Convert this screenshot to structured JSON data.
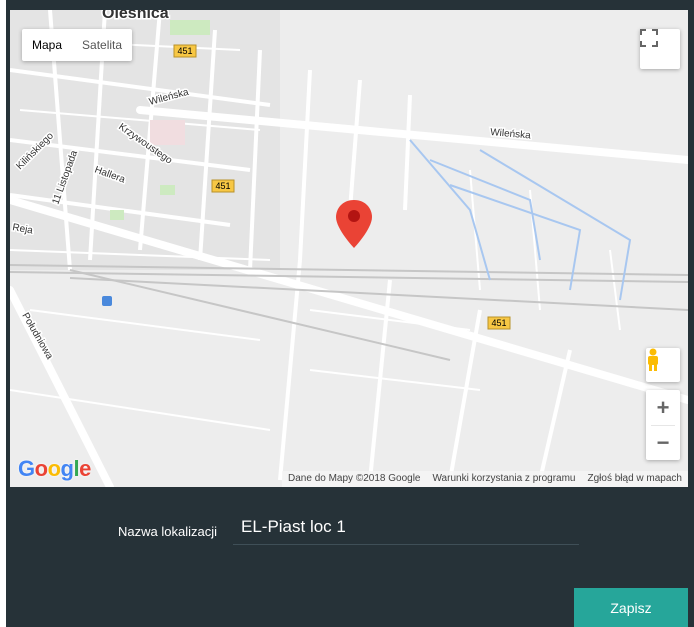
{
  "map": {
    "maptype": {
      "map_label": "Mapa",
      "satellite_label": "Satelita",
      "active": "Mapa"
    },
    "city_label": "Oleśnica",
    "streets": [
      "Wileńska",
      "Wileńska",
      "Krzywoustego",
      "Kilińskiego",
      "11 Listopada",
      "Hallera",
      "Reja",
      "Południowa"
    ],
    "road_shields": [
      "451",
      "451",
      "451"
    ],
    "attribution": {
      "data": "Dane do Mapy ©2018 Google",
      "terms": "Warunki korzystania z programu",
      "report": "Zgłoś błąd w mapach"
    },
    "logo": "Google",
    "icons": {
      "fullscreen": "fullscreen-icon",
      "pegman": "pegman-icon",
      "marker": "map-marker-icon",
      "zoom_in": "+",
      "zoom_out": "−"
    },
    "marker_color": "#ea4335"
  },
  "form": {
    "location_label": "Nazwa lokalizacji",
    "location_value": "EL-Piast loc 1",
    "save_label": "Zapisz"
  },
  "colors": {
    "panel": "#263238",
    "accent": "#26a69a"
  }
}
